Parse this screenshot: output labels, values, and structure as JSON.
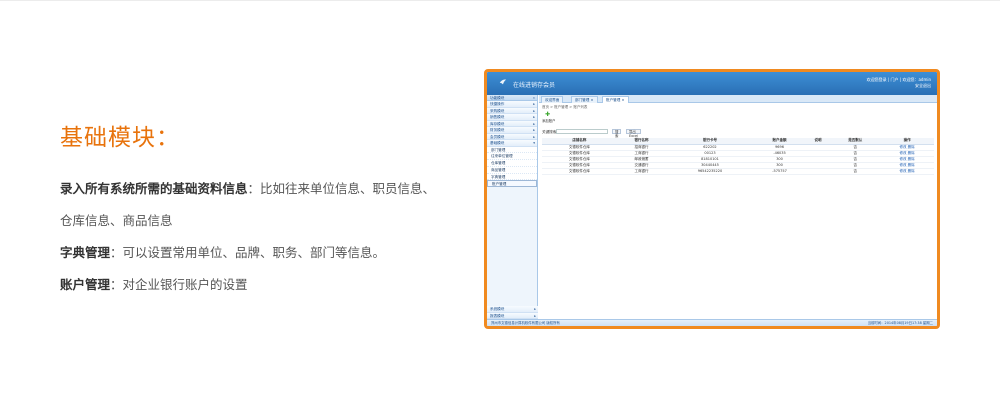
{
  "section": {
    "title": "基础模块：",
    "lines": [
      {
        "bold": "录入所有系统所需的基础资料信息",
        "text": "：比如往来单位信息、职员信息、"
      },
      {
        "bold": "",
        "text": "仓库信息、商品信息"
      },
      {
        "bold": "字典管理",
        "text": "：可以设置常用单位、品牌、职务、部门等信息。"
      },
      {
        "bold": "账户管理",
        "text": "：对企业银行账户的设置"
      }
    ]
  },
  "app": {
    "title": "在线进销存会员",
    "user_line1": "欢迎您登录 | 门户 | 欢迎您：admin",
    "user_line2": "安全退出",
    "sidebar": {
      "header": "功能模块",
      "items": [
        "快捷操作",
        "采购模块",
        "销售模块",
        "库存模块",
        "财务模块",
        "会员模块",
        "基础模块"
      ],
      "subitems": [
        "部门管理",
        "往来单位管理",
        "仓库管理",
        "商品管理",
        "字典管理",
        "账户管理"
      ],
      "bottom": [
        "系统模块",
        "报表模块"
      ]
    },
    "tabs": [
      "欢迎界面",
      "部门管理",
      "账户管理"
    ],
    "breadcrumb": "首页 > 账户管理 > 账户列表",
    "add_label": "添加账户",
    "search_label": "关键搜索：",
    "search_button": "搜 索",
    "export_button": "导出Excel",
    "table": {
      "headers": [
        "店铺名称",
        "银行名称",
        "银行卡号",
        "账户金额",
        "说明",
        "是否默认",
        "操作"
      ],
      "rows": [
        [
          "文德软件仓库",
          "招商银行",
          "622202",
          "9696",
          "",
          "否",
          "修改 删除"
        ],
        [
          "文德软件仓库",
          "工商银行",
          "00123",
          "-46035",
          "",
          "否",
          "修改 删除"
        ],
        [
          "文德软件仓库",
          "邮政储蓄",
          "81810101",
          "300",
          "",
          "否",
          "修改 删除"
        ],
        [
          "文德软件仓库",
          "交通银行",
          "30440445",
          "300",
          "",
          "否",
          "修改 删除"
        ],
        [
          "文德软件仓库",
          "工商银行",
          "96542235220",
          "-575757",
          "",
          "否",
          "修改 删除"
        ]
      ]
    },
    "status_left": "郑州市文德信息计算机软件有限公司 版权所有",
    "status_right": "当前时间：2014年08月19日17:38 星期二"
  }
}
